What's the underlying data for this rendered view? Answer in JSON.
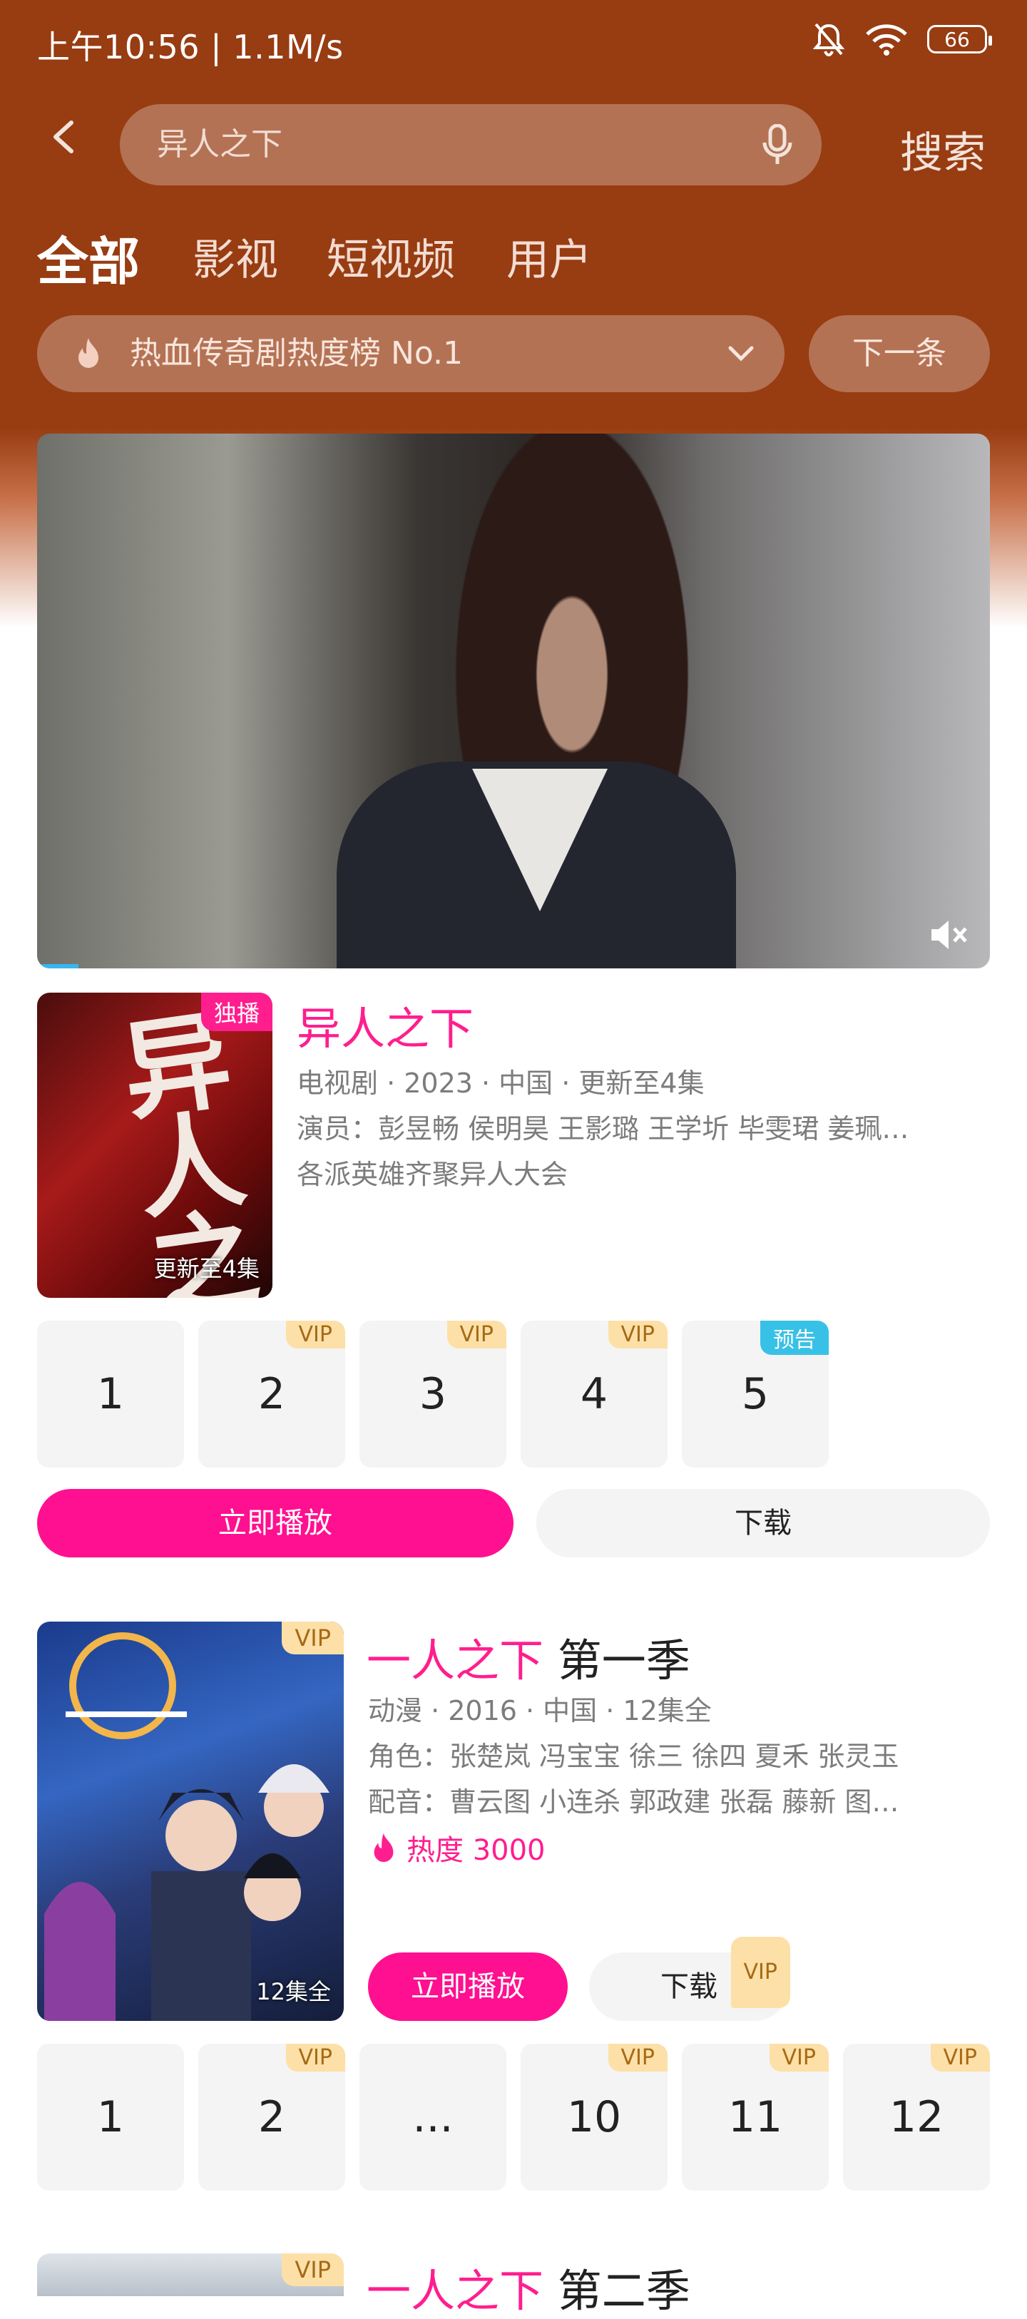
{
  "status": {
    "time": "上午10:56 | 1.1M/s",
    "battery": "66"
  },
  "search": {
    "query": "异人之下",
    "button": "搜索"
  },
  "tabs": [
    {
      "label": "全部",
      "active": true
    },
    {
      "label": "影视",
      "active": false
    },
    {
      "label": "短视频",
      "active": false
    },
    {
      "label": "用户",
      "active": false
    }
  ],
  "hot": {
    "text": "热血传奇剧热度榜 No.1",
    "next": "下一条"
  },
  "result1": {
    "title": "异人之下",
    "badge": "独播",
    "poster_caption": "更新至4集",
    "poster_art": "异人之下",
    "meta": "电视剧 · 2023 · 中国 · 更新至4集",
    "cast": "演员：彭昱畅 侯明昊 王影璐 王学圻 毕雯珺 姜珮…",
    "desc": "各派英雄齐聚异人大会",
    "episodes": [
      {
        "num": "1",
        "badge": ""
      },
      {
        "num": "2",
        "badge": "VIP"
      },
      {
        "num": "3",
        "badge": "VIP"
      },
      {
        "num": "4",
        "badge": "VIP"
      },
      {
        "num": "5",
        "badge": "预告"
      }
    ],
    "play": "立即播放",
    "download": "下载"
  },
  "result2": {
    "title_hl": "一人之下",
    "title_rest": " 第一季",
    "badge": "VIP",
    "poster_caption": "12集全",
    "meta": "动漫 · 2016 · 中国 · 12集全",
    "roles": "角色：张楚岚 冯宝宝 徐三 徐四 夏禾 张灵玉",
    "voices": "配音：曹云图 小连杀 郭政建 张磊 藤新 图…",
    "heat": "热度 3000",
    "play": "立即播放",
    "download": "下载",
    "download_badge": "VIP",
    "episodes": [
      {
        "num": "1",
        "badge": ""
      },
      {
        "num": "2",
        "badge": "VIP"
      },
      {
        "num": "...",
        "badge": ""
      },
      {
        "num": "10",
        "badge": "VIP"
      },
      {
        "num": "11",
        "badge": "VIP"
      },
      {
        "num": "12",
        "badge": "VIP"
      }
    ]
  },
  "result3": {
    "title_hl": "一人之下",
    "title_rest": " 第二季",
    "badge": "VIP"
  }
}
